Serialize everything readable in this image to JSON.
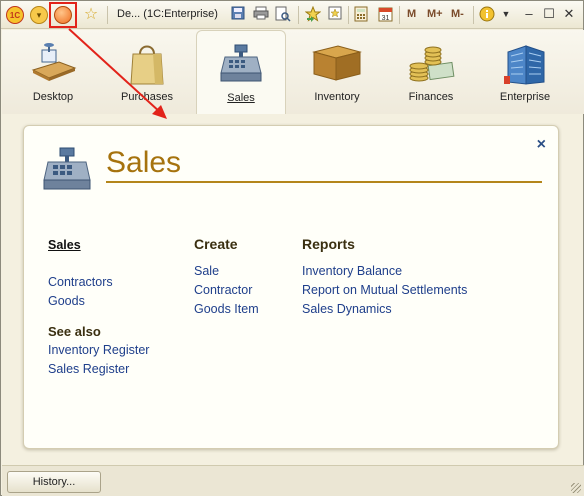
{
  "window": {
    "title": "De...  (1C:Enterprise)",
    "logo_text": "1C",
    "memory_buttons": [
      "M",
      "M+",
      "M-"
    ]
  },
  "sections": [
    {
      "label": "Desktop",
      "icon": "desktop-icon",
      "active": false
    },
    {
      "label": "Purchases",
      "icon": "shopping-bag-icon",
      "active": false
    },
    {
      "label": "Sales",
      "icon": "cash-register-icon",
      "active": true
    },
    {
      "label": "Inventory",
      "icon": "box-icon",
      "active": false
    },
    {
      "label": "Finances",
      "icon": "coins-icon",
      "active": false
    },
    {
      "label": "Enterprise",
      "icon": "building-icon",
      "active": false
    }
  ],
  "panel": {
    "title": "Sales",
    "close_symbol": "×",
    "nav": {
      "current": "Sales",
      "items": [
        "Contractors",
        "Goods"
      ],
      "see_also_heading": "See also",
      "see_also": [
        "Inventory Register",
        "Sales Register"
      ]
    },
    "create": {
      "heading": "Create",
      "items": [
        "Sale",
        "Contractor",
        "Goods Item"
      ]
    },
    "reports": {
      "heading": "Reports",
      "items": [
        "Inventory Balance",
        "Report on Mutual Settlements",
        "Sales Dynamics"
      ]
    }
  },
  "footer": {
    "history_label": "History..."
  },
  "colors": {
    "accent_title": "#a6730e",
    "link": "#1f3f8b",
    "annotation": "#e2231a"
  }
}
